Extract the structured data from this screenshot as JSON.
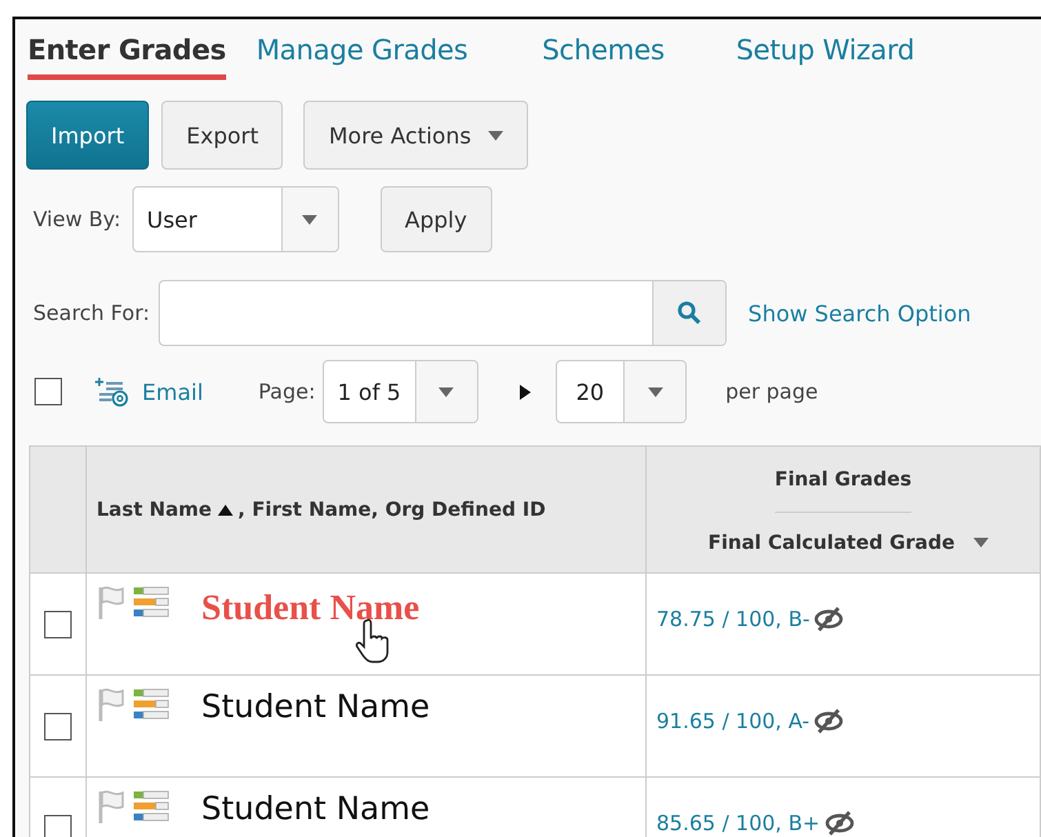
{
  "tabs": [
    {
      "label": "Enter Grades",
      "selected": true
    },
    {
      "label": "Manage Grades",
      "selected": false
    },
    {
      "label": "Schemes",
      "selected": false
    },
    {
      "label": "Setup Wizard",
      "selected": false
    }
  ],
  "actions": [
    {
      "label": "Import",
      "kind": "primary"
    },
    {
      "label": "Export",
      "kind": "plain"
    },
    {
      "label": "More Actions",
      "kind": "menu"
    }
  ],
  "view_by": {
    "label": "View By:",
    "value": "User"
  },
  "apply_button": "Apply",
  "search": {
    "label": "Search For:"
  },
  "show_search_options": "Show Search Option",
  "select_all": {
    "checked": false
  },
  "email_link": "Email",
  "page": {
    "label": "Page:",
    "value": "1 of 5"
  },
  "per_page": {
    "value": "20",
    "label": "per page"
  },
  "table": {
    "name_column": {
      "sorted": "Last Name",
      "rest": ", First Name, Org Defined ID"
    },
    "group_column": "Final Grades",
    "grade_column": "Final Calculated Grade",
    "rows": [
      {
        "checked": false,
        "name": "Student Name",
        "highlighted": true,
        "grade": "78.75 / 100, B-"
      },
      {
        "checked": false,
        "name": "Student Name",
        "highlighted": false,
        "grade": "91.65 / 100, A-"
      },
      {
        "checked": false,
        "name": "Student Name",
        "highlighted": false,
        "grade": "85.65 / 100, B+"
      }
    ]
  }
}
